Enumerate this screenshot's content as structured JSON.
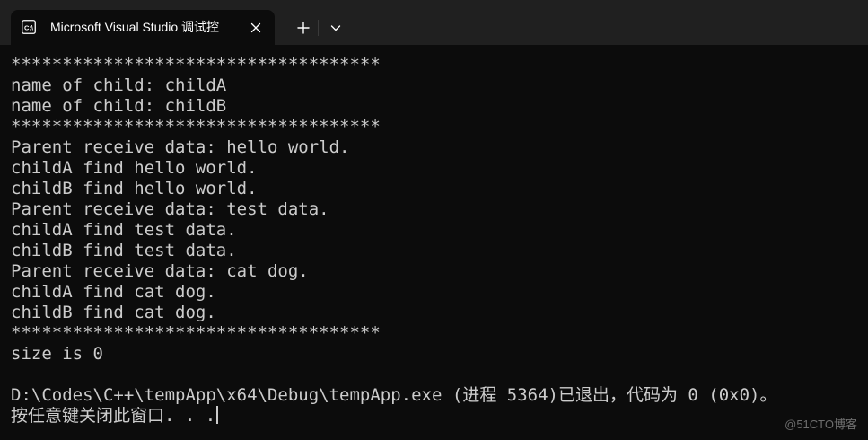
{
  "window": {
    "tab_title": "Microsoft Visual Studio 调试控",
    "tab_icon": "console-icon",
    "close_icon": "close-icon",
    "new_tab_icon": "plus-icon",
    "dropdown_icon": "chevron-down-icon"
  },
  "console": {
    "lines": [
      "************************************",
      "name of child: childA",
      "name of child: childB",
      "************************************",
      "Parent receive data: hello world.",
      "childA find hello world.",
      "childB find hello world.",
      "Parent receive data: test data.",
      "childA find test data.",
      "childB find test data.",
      "Parent receive data: cat dog.",
      "childA find cat dog.",
      "childB find cat dog.",
      "************************************",
      "size is 0",
      "",
      "D:\\Codes\\C++\\tempApp\\x64\\Debug\\tempApp.exe (进程 5364)已退出，代码为 0 (0x0)。",
      "按任意键关闭此窗口. . ."
    ]
  },
  "watermark": "@51CTO博客",
  "colors": {
    "background": "#0c0c0c",
    "titlebar": "#202020",
    "text": "#cccccc",
    "tab_text": "#ffffff"
  }
}
